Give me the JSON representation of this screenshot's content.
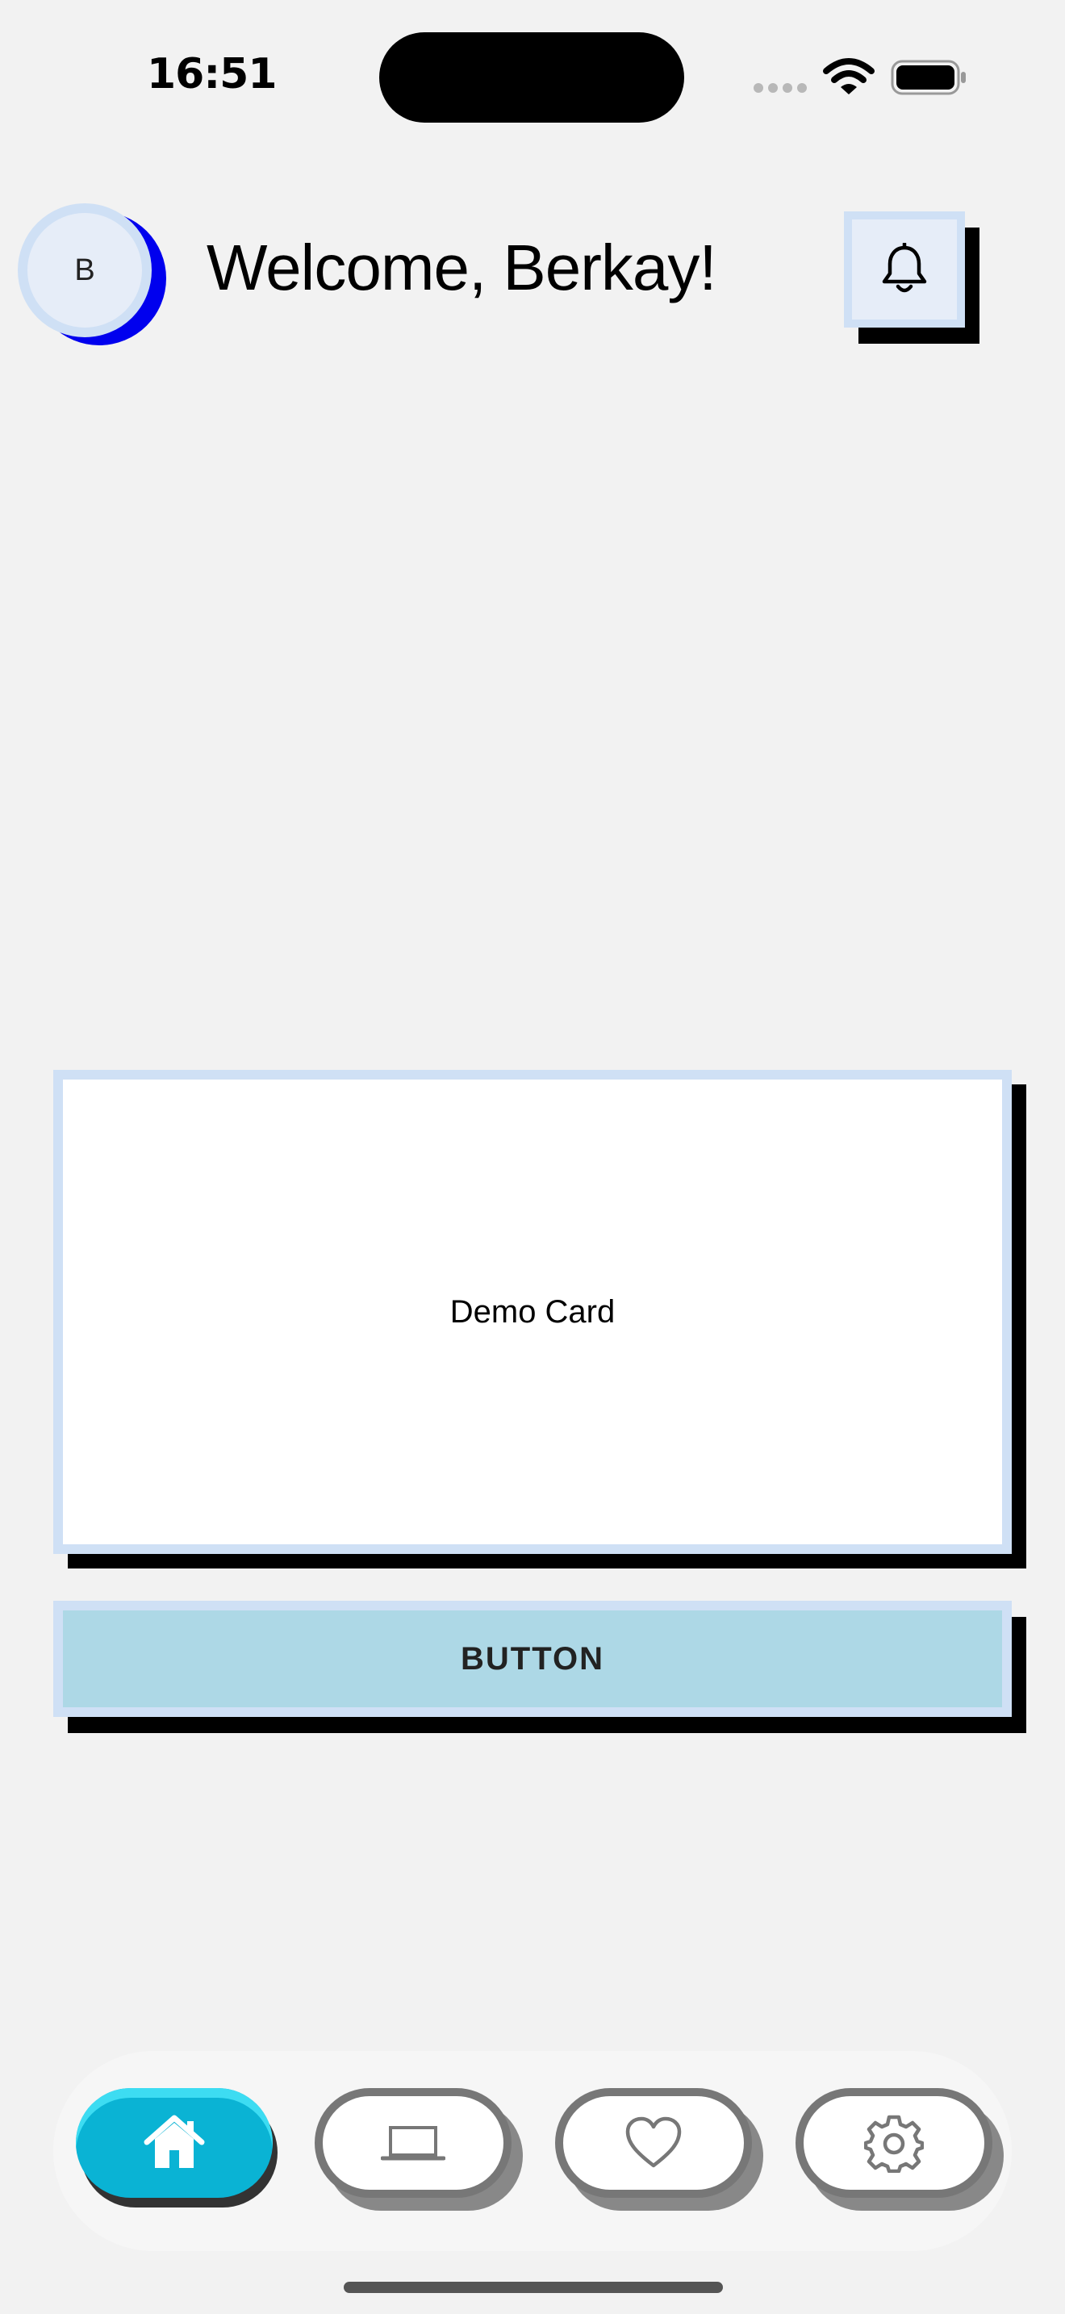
{
  "status_bar": {
    "time": "16:51",
    "icons": [
      "cellular-signal-icon",
      "wifi-icon",
      "battery-icon"
    ]
  },
  "header": {
    "avatar_initial": "B",
    "welcome_text": "Welcome, Berkay!",
    "notification_icon": "bell-icon"
  },
  "card": {
    "label": "Demo Card"
  },
  "main_button": {
    "label": "BUTTON"
  },
  "bottom_nav": {
    "items": [
      {
        "icon": "home-icon",
        "active": true
      },
      {
        "icon": "laptop-icon",
        "active": false
      },
      {
        "icon": "heart-icon",
        "active": false
      },
      {
        "icon": "gear-icon",
        "active": false
      }
    ]
  },
  "colors": {
    "background": "#f2f2f2",
    "accent_blue_shadow": "#0000ee",
    "border_light_blue": "#cfe0f5",
    "button_fill": "#add8e6",
    "nav_active": "#0ab3d4",
    "nav_inactive_border": "#777777"
  }
}
